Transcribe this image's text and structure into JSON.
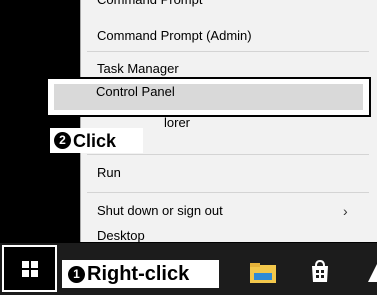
{
  "menu": {
    "items": [
      {
        "label": "Command Prompt"
      },
      {
        "label": "Command Prompt (Admin)"
      },
      {
        "label": "Task Manager"
      },
      {
        "label": "Control Panel"
      },
      {
        "label": "lorer"
      },
      {
        "label": "Run"
      },
      {
        "label": "Shut down or sign out"
      },
      {
        "label": "Desktop"
      }
    ],
    "shutdown_chevron": "›"
  },
  "callouts": {
    "click": {
      "number": "2",
      "label": "Click"
    },
    "right_click": {
      "number": "1",
      "label": "Right-click"
    }
  },
  "taskbar": {
    "icons": [
      "windows-start-icon",
      "folder-icon",
      "store-icon",
      "edge-icon"
    ]
  },
  "colors": {
    "menu_bg": "#f2f2f2",
    "highlight_bg": "#d9d9d9",
    "taskbar_bg": "#1c1c1c",
    "folder_yellow": "#f2c74b",
    "folder_blue": "#2f8ad6"
  }
}
